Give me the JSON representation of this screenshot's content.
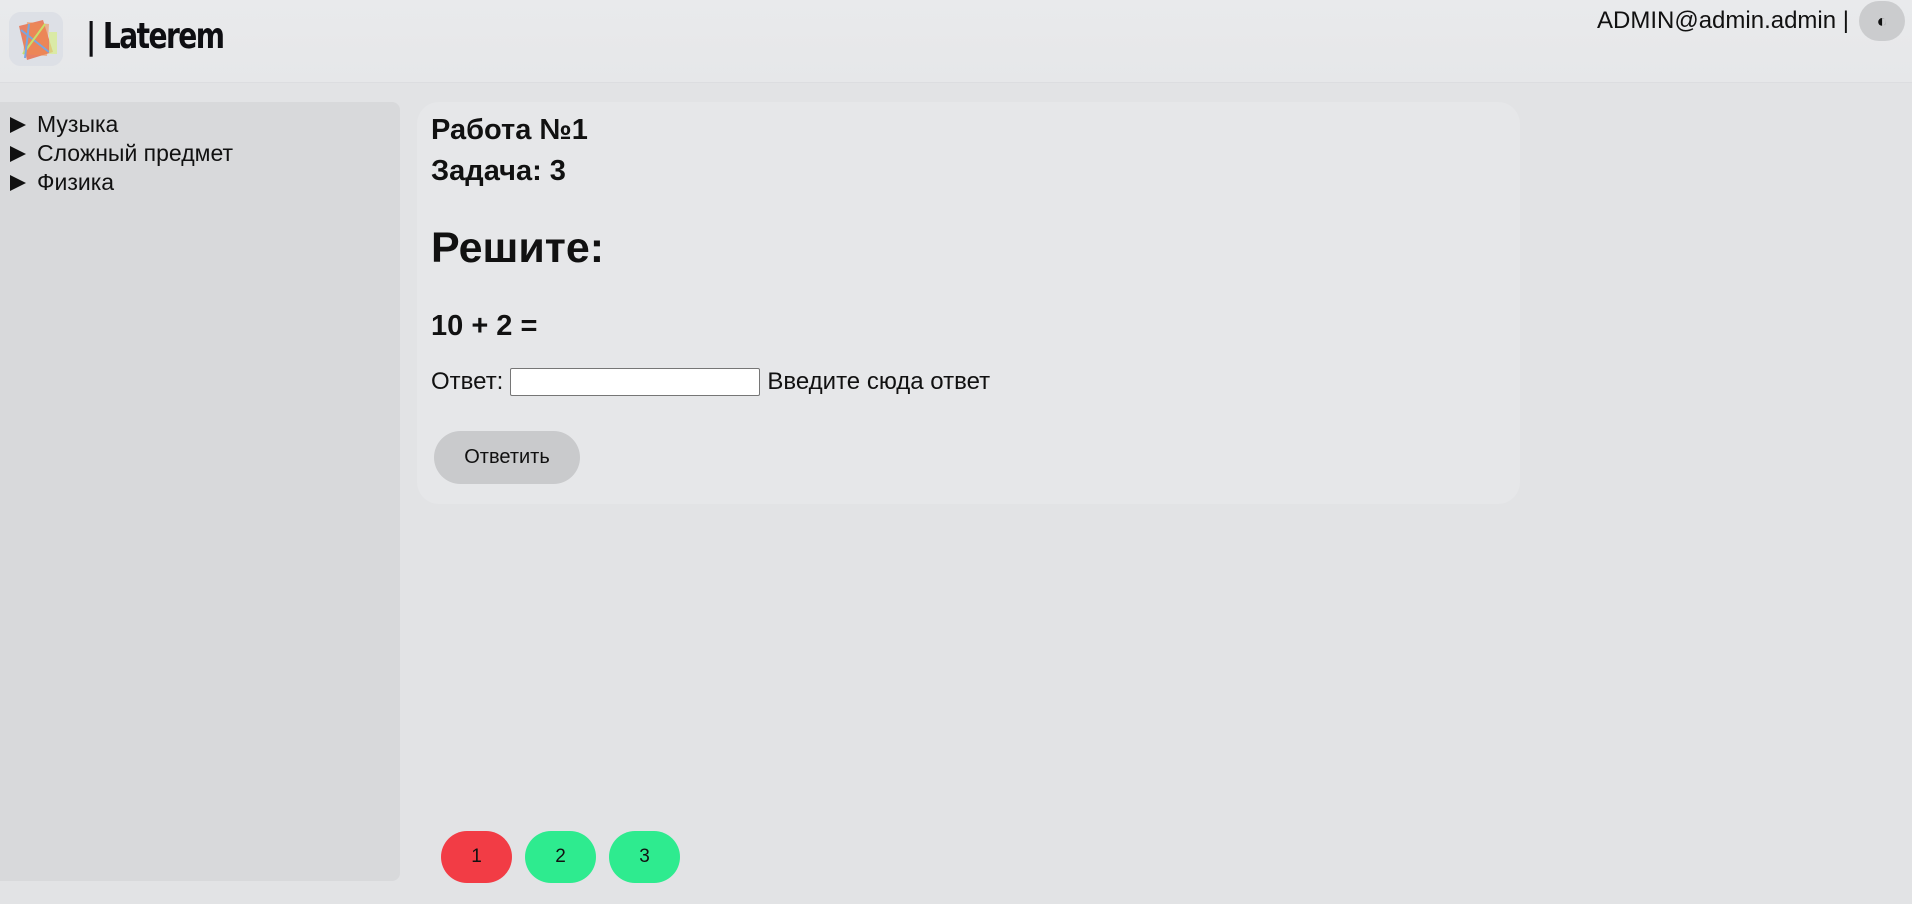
{
  "header": {
    "brand": "| Laterem",
    "user_label": "ADMIN@admin.admin |",
    "theme_toggle_glyph": "◐",
    "logo_icon": "laterem-logo-icon"
  },
  "sidebar": {
    "items": [
      {
        "label": "Музыка",
        "icon": "triangle-right-icon"
      },
      {
        "label": "Сложный предмет",
        "icon": "triangle-right-icon"
      },
      {
        "label": "Физика",
        "icon": "triangle-right-icon"
      }
    ]
  },
  "task": {
    "work_title": "Работа №1",
    "task_title": "Задача: 3",
    "heading": "Решите:",
    "expression": "10 + 2 =",
    "answer_label": "Ответ:",
    "answer_value": "",
    "answer_hint": "Введите сюда ответ",
    "submit_label": "Ответить"
  },
  "pager": {
    "pages": [
      {
        "label": "1",
        "status": "wrong",
        "color": "#f23c45"
      },
      {
        "label": "2",
        "status": "correct",
        "color": "#2eeb8f"
      },
      {
        "label": "3",
        "status": "correct",
        "color": "#2eeb8f"
      }
    ]
  }
}
